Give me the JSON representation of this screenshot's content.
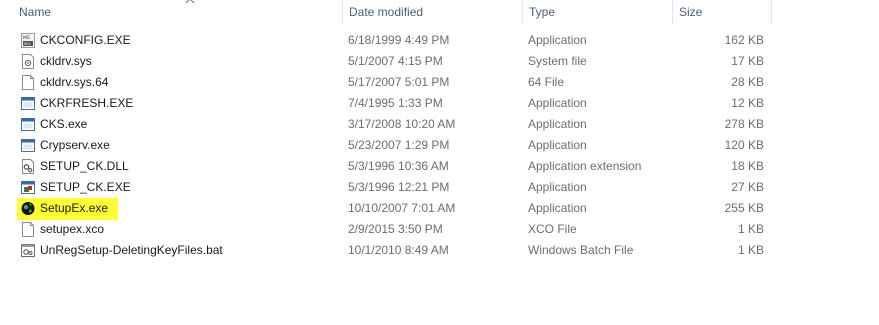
{
  "columns": {
    "name": "Name",
    "date": "Date modified",
    "type": "Type",
    "size": "Size"
  },
  "files": [
    {
      "name": "CKCONFIG.EXE",
      "date": "6/18/1999 4:49 PM",
      "type": "Application",
      "size": "162 KB",
      "icon": "config-exe-icon"
    },
    {
      "name": "ckldrv.sys",
      "date": "5/1/2007 4:15 PM",
      "type": "System file",
      "size": "17 KB",
      "icon": "system-file-icon"
    },
    {
      "name": "ckldrv.sys.64",
      "date": "5/17/2007 5:01 PM",
      "type": "64 File",
      "size": "28 KB",
      "icon": "blank-file-icon"
    },
    {
      "name": "CKRFRESH.EXE",
      "date": "7/4/1995 1:33 PM",
      "type": "Application",
      "size": "12 KB",
      "icon": "application-icon"
    },
    {
      "name": "CKS.exe",
      "date": "3/17/2008 10:20 AM",
      "type": "Application",
      "size": "278 KB",
      "icon": "application-icon"
    },
    {
      "name": "Crypserv.exe",
      "date": "5/23/2007 1:29 PM",
      "type": "Application",
      "size": "120 KB",
      "icon": "application-icon"
    },
    {
      "name": "SETUP_CK.DLL",
      "date": "5/3/1996 10:36 AM",
      "type": "Application extension",
      "size": "18 KB",
      "icon": "dll-gear-icon"
    },
    {
      "name": "SETUP_CK.EXE",
      "date": "5/3/1996 12:21 PM",
      "type": "Application",
      "size": "27 KB",
      "icon": "setup-exe-icon"
    },
    {
      "name": "SetupEx.exe",
      "date": "10/10/2007 7:01 AM",
      "type": "Application",
      "size": "255 KB",
      "icon": "globe-setup-icon",
      "highlighted": true
    },
    {
      "name": "setupex.xco",
      "date": "2/9/2015 3:50 PM",
      "type": "XCO File",
      "size": "1 KB",
      "icon": "blank-file-icon"
    },
    {
      "name": "UnRegSetup-DeletingKeyFiles.bat",
      "date": "10/1/2010 8:49 AM",
      "type": "Windows Batch File",
      "size": "1 KB",
      "icon": "batch-file-icon"
    }
  ],
  "colors": {
    "highlight": "#ffff33",
    "header_text": "#4c607a",
    "detail_text": "#6d6d6d"
  }
}
